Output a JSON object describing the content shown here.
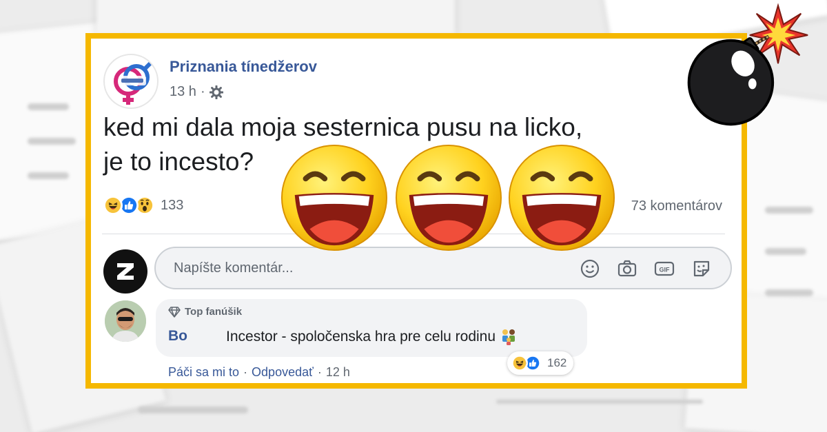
{
  "post": {
    "page_name": "Priznania tínedžerov",
    "time": "13 h",
    "separator": "·",
    "privacy_icon": "gear-icon",
    "text_line1": "ked mi dala moja sesternica pusu na licko,",
    "text_line2": "je to incesto?",
    "reactions": [
      "haha",
      "like",
      "wow"
    ],
    "reaction_count": "133",
    "comments_count": "73 komentárov"
  },
  "composer": {
    "placeholder": "Napíšte komentár...",
    "icons": [
      "emoji-icon",
      "camera-icon",
      "gif-icon",
      "sticker-icon"
    ]
  },
  "comment": {
    "badge": "Top fanúšik",
    "author": "Bo",
    "text": "Incestor - spoločenska hra pre celu rodinu",
    "reactions": [
      "haha",
      "like"
    ],
    "reaction_count": "162",
    "like_label": "Páči sa mi to",
    "reply_label": "Odpovedať",
    "sep": "·",
    "time": "12 h"
  },
  "overlay": {
    "emoji_count": 3,
    "emoji_icon": "laughing-face-icon",
    "bomb_icon": "bomb-icon"
  },
  "colors": {
    "frame": "#f5b800",
    "link": "#385898",
    "meta": "#606770",
    "text": "#1c1e21"
  }
}
